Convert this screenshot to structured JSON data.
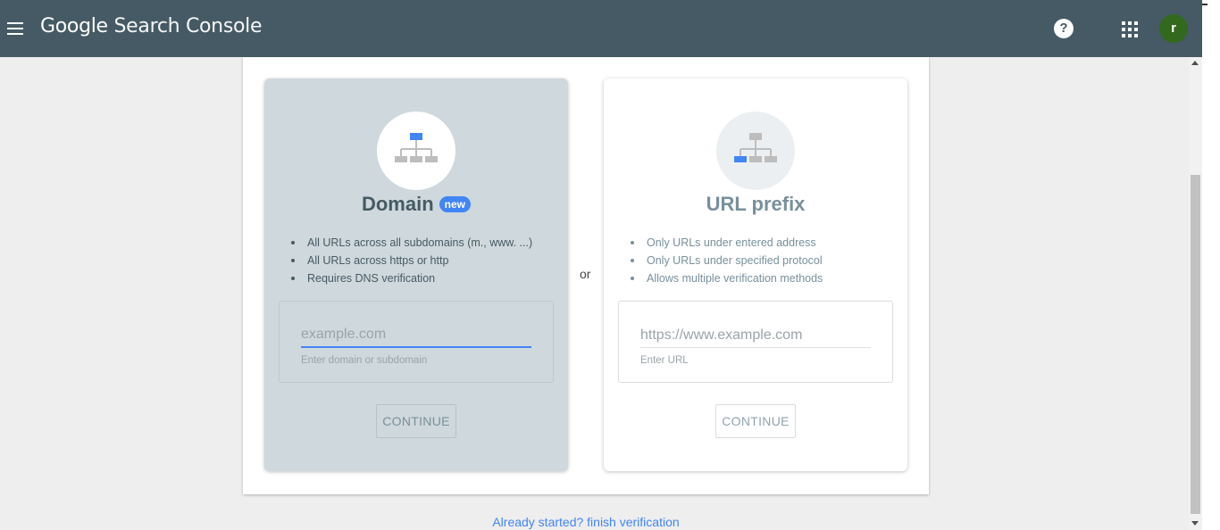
{
  "header": {
    "brand_google": "Google",
    "brand_product": "Search Console",
    "help_icon": "help-circle-icon",
    "apps_icon": "apps-grid-icon",
    "avatar_letter": "r"
  },
  "or_label": "or",
  "domain_card": {
    "title": "Domain",
    "badge": "new",
    "features": [
      "All URLs across all subdomains (m., www. ...)",
      "All URLs across https or http",
      "Requires DNS verification"
    ],
    "input_value": "",
    "input_placeholder": "example.com",
    "input_hint": "Enter domain or subdomain",
    "continue_label": "CONTINUE"
  },
  "prefix_card": {
    "title": "URL prefix",
    "features": [
      "Only URLs under entered address",
      "Only URLs under specified protocol",
      "Allows multiple verification methods"
    ],
    "input_value": "",
    "input_placeholder": "https://www.example.com",
    "input_hint": "Enter URL",
    "continue_label": "CONTINUE"
  },
  "footer_link": "Already started? finish verification",
  "colors": {
    "appbar": "#455a64",
    "accent": "#4285f4",
    "domain_card_bg": "#cfd8dc",
    "avatar_bg": "#33691e"
  }
}
